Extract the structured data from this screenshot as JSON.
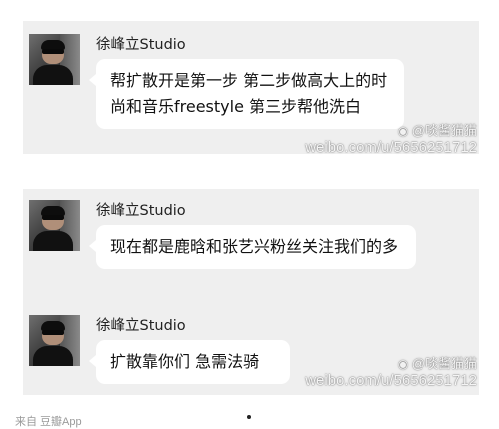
{
  "messages": [
    {
      "sender": "徐峰立Studio",
      "text": "帮扩散开是第一步 第二步做高大上的时尚和音乐freestyle 第三步帮他洗白"
    },
    {
      "sender": "徐峰立Studio",
      "text": "现在都是鹿晗和张艺兴粉丝关注我们的多"
    },
    {
      "sender": "徐峰立Studio",
      "text": "扩散靠你们 急需法骑"
    }
  ],
  "watermarks": [
    {
      "handle": "@啖酱猫猫",
      "url": "weibo.com/u/5656251712"
    },
    {
      "handle": "@啖酱猫猫",
      "url": "weibo.com/u/5656251712"
    }
  ],
  "footer": {
    "source": "来自 豆瓣App"
  },
  "colors": {
    "panel_bg": "#efefef",
    "bubble_bg": "#ffffff",
    "page_bg": "#ffffff"
  },
  "icons": {
    "avatar": "avatar-photo",
    "watermark": "weibo-icon"
  }
}
